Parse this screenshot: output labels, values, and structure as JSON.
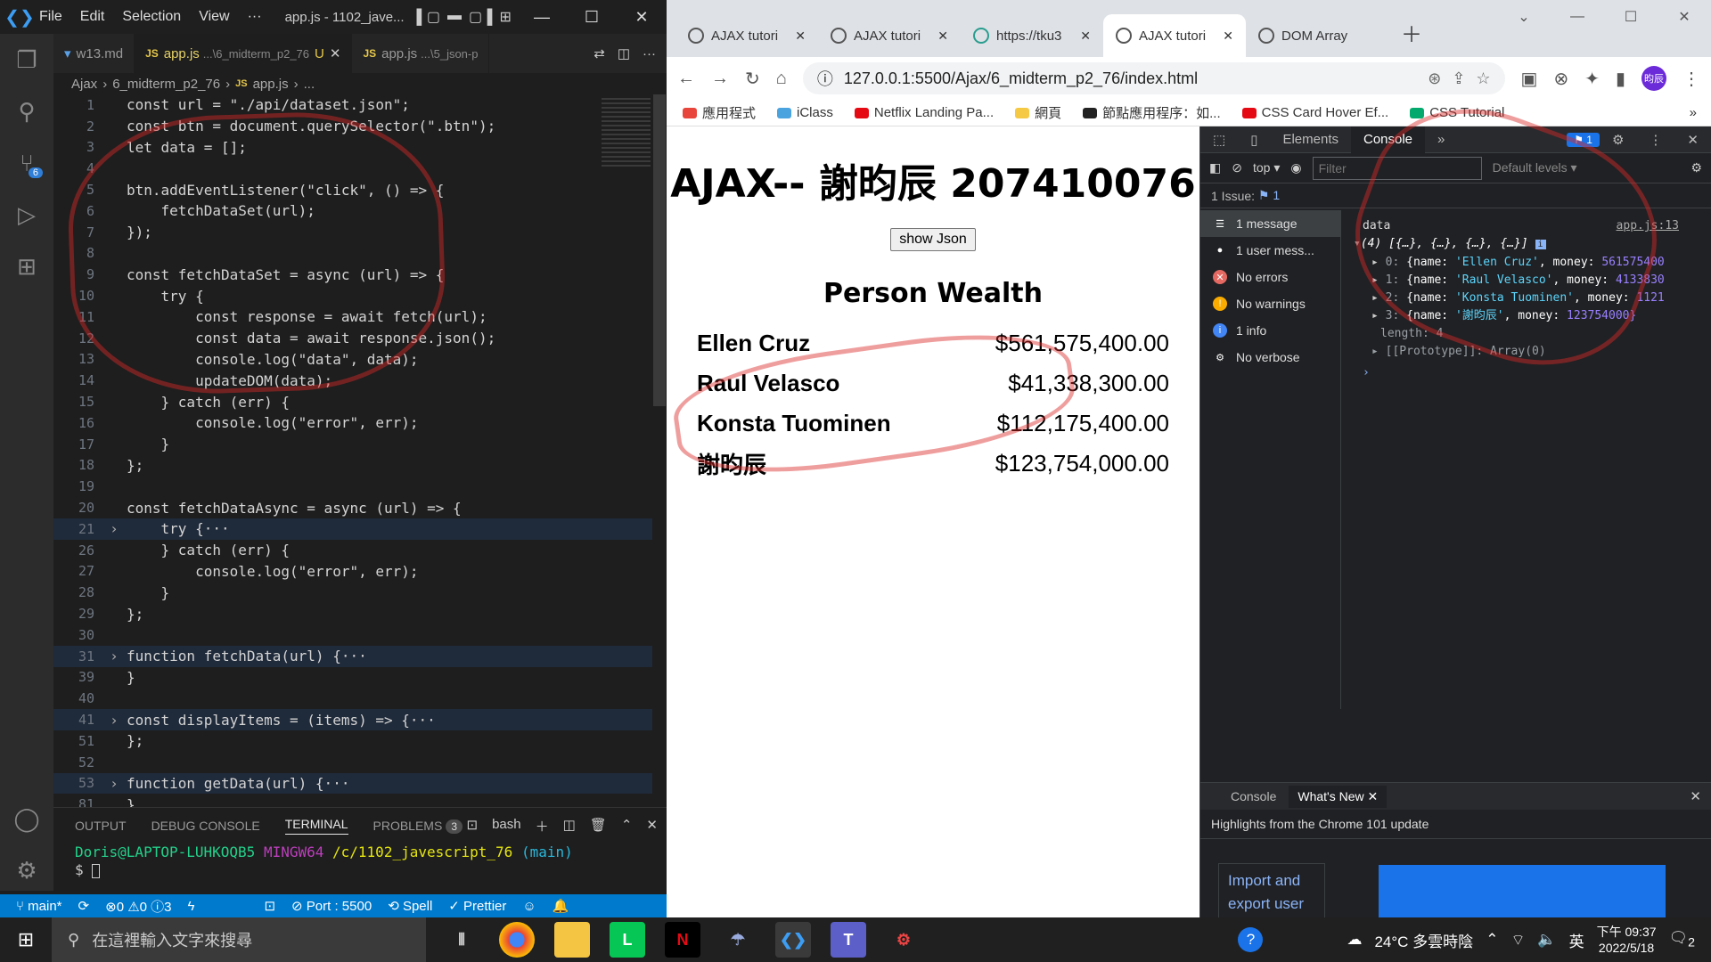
{
  "vscode": {
    "menu": [
      "File",
      "Edit",
      "Selection",
      "View",
      "···"
    ],
    "window_title": "app.js - 1102_jave...",
    "tabs": [
      {
        "label": "w13.md",
        "sub": "",
        "active": false
      },
      {
        "label": "app.js",
        "sub": "...\\6_midterm_p2_76",
        "modified": "U",
        "active": true
      },
      {
        "label": "app.js",
        "sub": "...\\5_json-p",
        "active": false
      }
    ],
    "breadcrumb": [
      "Ajax",
      "6_midterm_p2_76",
      "app.js",
      "..."
    ],
    "code": [
      {
        "n": "1",
        "text": "const url = \"./api/dataset.json\";"
      },
      {
        "n": "2",
        "text": "const btn = document.querySelector(\".btn\");"
      },
      {
        "n": "3",
        "text": "let data = [];"
      },
      {
        "n": "4",
        "text": ""
      },
      {
        "n": "5",
        "text": "btn.addEventListener(\"click\", () => {"
      },
      {
        "n": "6",
        "text": "    fetchDataSet(url);"
      },
      {
        "n": "7",
        "text": "});"
      },
      {
        "n": "8",
        "text": ""
      },
      {
        "n": "9",
        "text": "const fetchDataSet = async (url) => {"
      },
      {
        "n": "10",
        "text": "    try {"
      },
      {
        "n": "11",
        "text": "        const response = await fetch(url);"
      },
      {
        "n": "12",
        "text": "        const data = await response.json();"
      },
      {
        "n": "13",
        "text": "        console.log(\"data\", data);"
      },
      {
        "n": "14",
        "text": "        updateDOM(data);"
      },
      {
        "n": "15",
        "text": "    } catch (err) {"
      },
      {
        "n": "16",
        "text": "        console.log(\"error\", err);"
      },
      {
        "n": "17",
        "text": "    }"
      },
      {
        "n": "18",
        "text": "};"
      },
      {
        "n": "19",
        "text": ""
      },
      {
        "n": "20",
        "text": "const fetchDataAsync = async (url) => {"
      },
      {
        "n": "21",
        "text": "    try {···",
        "fold": true
      },
      {
        "n": "26",
        "text": "    } catch (err) {"
      },
      {
        "n": "27",
        "text": "        console.log(\"error\", err);"
      },
      {
        "n": "28",
        "text": "    }"
      },
      {
        "n": "29",
        "text": "};"
      },
      {
        "n": "30",
        "text": ""
      },
      {
        "n": "31",
        "text": "function fetchData(url) {···",
        "fold": true
      },
      {
        "n": "39",
        "text": "}"
      },
      {
        "n": "40",
        "text": ""
      },
      {
        "n": "41",
        "text": "const displayItems = (items) => {···",
        "fold": true
      },
      {
        "n": "51",
        "text": "};"
      },
      {
        "n": "52",
        "text": ""
      },
      {
        "n": "53",
        "text": "function getData(url) {···",
        "fold": true
      },
      {
        "n": "81",
        "text": "}"
      }
    ],
    "panel": {
      "tabs": [
        "OUTPUT",
        "DEBUG CONSOLE",
        "TERMINAL",
        "PROBLEMS"
      ],
      "problems_count": "3",
      "shell": "bash",
      "term_user": "Doris@LAPTOP-LUHKOQB5",
      "term_host": "MINGW64",
      "term_path": "/c/1102_javescript_76",
      "term_branch": "(main)",
      "prompt": "$"
    },
    "status": {
      "branch": "main*",
      "errors": "0",
      "warnings": "0",
      "info": "3",
      "port": "Port : 5500",
      "spell": "Spell",
      "prettier": "Prettier"
    },
    "scm_badge": "6"
  },
  "chrome": {
    "tabs": [
      {
        "label": "AJAX tutori",
        "active": false
      },
      {
        "label": "AJAX tutori",
        "active": false
      },
      {
        "label": "https://tku3",
        "active": false
      },
      {
        "label": "AJAX tutori",
        "active": true
      },
      {
        "label": "DOM Array",
        "active": false
      }
    ],
    "url": "127.0.0.1:5500/Ajax/6_midterm_p2_76/index.html",
    "profile": "昀辰",
    "bookmarks": [
      {
        "label": "應用程式",
        "color": "#e8453c"
      },
      {
        "label": "iClass",
        "color": "#4aa3df"
      },
      {
        "label": "Netflix Landing Pa...",
        "color": "#e50914"
      },
      {
        "label": "網頁",
        "color": "#f6c945"
      },
      {
        "label": "節點應用程序：如...",
        "color": "#222222"
      },
      {
        "label": "CSS Card Hover Ef...",
        "color": "#e50914"
      },
      {
        "label": "CSS Tutorial",
        "color": "#04aa6d"
      }
    ]
  },
  "page": {
    "title": "AJAX-- 謝昀辰 207410076",
    "button": "show Json",
    "heading": "Person Wealth",
    "people": [
      {
        "name": "Ellen Cruz",
        "money": "$561,575,400.00"
      },
      {
        "name": "Raul Velasco",
        "money": "$41,338,300.00"
      },
      {
        "name": "Konsta Tuominen",
        "money": "$112,175,400.00"
      },
      {
        "name": "謝昀辰",
        "money": "$123,754,000.00"
      }
    ]
  },
  "devtools": {
    "tabs": [
      "Elements",
      "Console"
    ],
    "issues_badge": "1",
    "context": "top",
    "filter_placeholder": "Filter",
    "levels": "Default levels",
    "issue_line": "1 Issue:",
    "issue_count": "1",
    "sidebar": [
      {
        "label": "1 message",
        "icon": "list-icon"
      },
      {
        "label": "1 user mess...",
        "icon": "user-icon"
      },
      {
        "label": "No errors",
        "icon": "error-icon"
      },
      {
        "label": "No warnings",
        "icon": "warning-icon"
      },
      {
        "label": "1 info",
        "icon": "info-icon"
      },
      {
        "label": "No verbose",
        "icon": "verbose-icon"
      }
    ],
    "console": {
      "label": "data",
      "source": "app.js:13",
      "summary": "(4) [{…}, {…}, {…}, {…}]",
      "items": [
        {
          "idx": "0:",
          "name": "'Ellen Cruz'",
          "money": "561575400"
        },
        {
          "idx": "1:",
          "name": "'Raul Velasco'",
          "money": "4133830"
        },
        {
          "idx": "2:",
          "name": "'Konsta Tuominen'",
          "money": "1121"
        },
        {
          "idx": "3:",
          "name": "'謝昀辰'",
          "money": "123754000}"
        }
      ],
      "length": "length: 4",
      "prototype": "[[Prototype]]: Array(0)"
    },
    "drawer": {
      "tabs": [
        "Console",
        "What's New"
      ],
      "headline": "Highlights from the Chrome 101 update",
      "card": "Import and export user"
    }
  },
  "taskbar": {
    "search_placeholder": "在這裡輸入文字來搜尋",
    "weather": "24°C  多雲時陰",
    "ime": "英",
    "time": "下午 09:37",
    "date": "2022/5/18",
    "notif": "2"
  }
}
